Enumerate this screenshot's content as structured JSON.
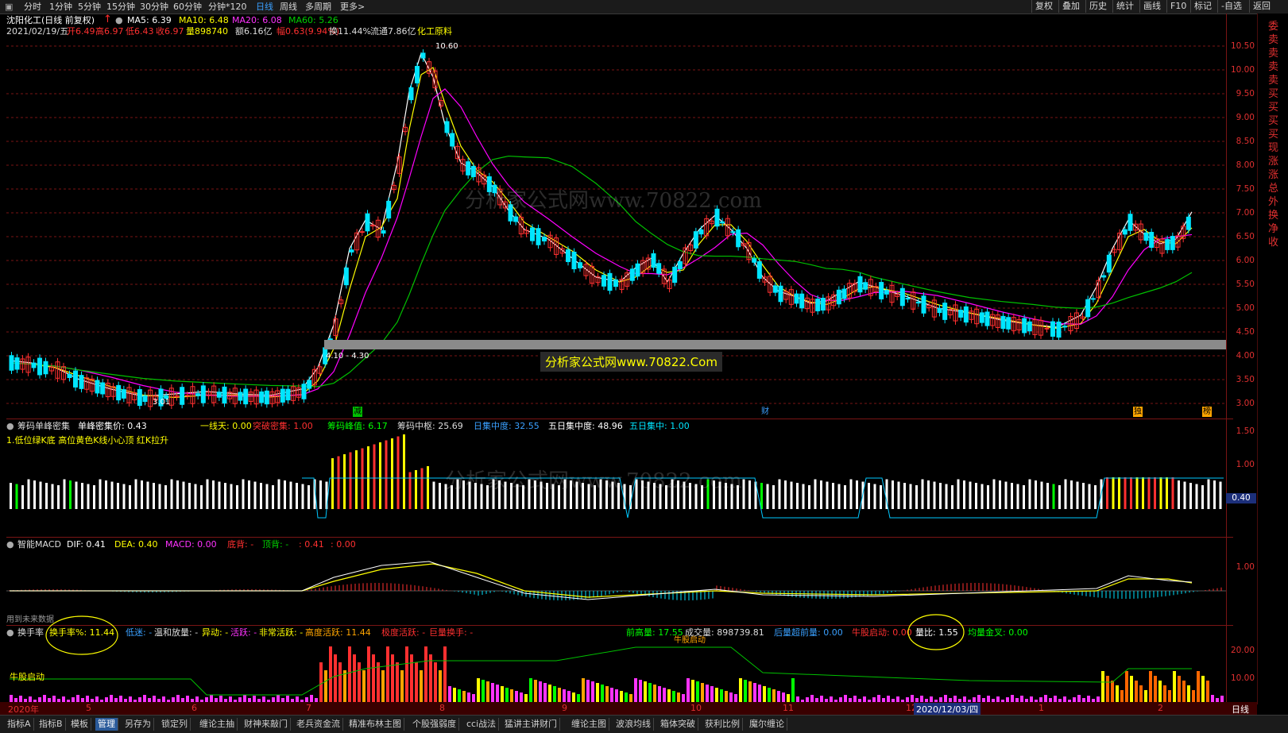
{
  "toolbar": {
    "tabs": [
      "分时",
      "1分钟",
      "5分钟",
      "15分钟",
      "30分钟",
      "60分钟",
      "分钟*120",
      "日线",
      "周线",
      "多周期",
      "更多>"
    ],
    "active_tab": "日线",
    "right_buttons": [
      "复权",
      "叠加",
      "历史",
      "统计",
      "画线",
      "F10",
      "标记",
      "-自选",
      "返回"
    ]
  },
  "main": {
    "stock_title": "沈阳化工(日线 前复权)",
    "ma5": "MA5: 6.39",
    "ma10": "MA10: 6.48",
    "ma20": "MA20: 6.08",
    "ma60": "MA60: 5.26",
    "date": "2021/02/19/五",
    "open": "开6.49",
    "high": "高6.97",
    "low": "低6.43",
    "close": "收6.97",
    "volume": "量898740",
    "amount": "额6.16亿",
    "change": "幅0.63(9.94%)",
    "turnover": "换11.44%",
    "float": "流通7.86亿",
    "sector": "化工原料",
    "high_label": "10.60",
    "low_label": "3.01",
    "range_label": "4.10 - 4.30",
    "banner": "分析家公式网www.70822.Com",
    "watermark": "分析家公式网www.70822.com",
    "markers": [
      "减",
      "财",
      "独",
      "榜"
    ],
    "axis": [
      "10.50",
      "10.00",
      "9.50",
      "9.00",
      "8.50",
      "8.00",
      "7.50",
      "7.00",
      "6.50",
      "6.00",
      "5.50",
      "5.00",
      "4.50",
      "4.00",
      "3.50",
      "3.00"
    ]
  },
  "chip": {
    "title": "筹码单峰密集",
    "price": "单峰密集价: 0.43",
    "yxt": "一线天: 0.00",
    "tpmj": "突破密集: 1.00",
    "peak": "筹码峰值: 6.17",
    "center": "筹码中枢: 25.69",
    "day_conc": "日集中度: 32.55",
    "five_conc": "五日集中度: 48.96",
    "five_set": "五日集中: 1.00",
    "note": "1.低位绿K底 高位黄色K线小心顶 红K拉升",
    "axis": [
      "1.50",
      "1.00",
      "0.40"
    ]
  },
  "macd": {
    "title": "智能MACD",
    "dif": "DIF: 0.41",
    "dea": "DEA: 0.40",
    "macd": "MACD: 0.00",
    "dibei": "底背: -",
    "dingbei": "顶背: -",
    "v1": ": 0.41",
    "v2": ": 0.00",
    "note": "用到未来数据",
    "axis": [
      "1.00"
    ]
  },
  "turnover": {
    "title": "换手率",
    "rate": "换手率%: 11.44",
    "low": "低迷: -",
    "mild": "温和放量: -",
    "abnormal": "异动: -",
    "active": "活跃: -",
    "very_active": "非常活跃: -",
    "high_active": "高度活跃: 11.44",
    "extreme": "极度活跃: -",
    "huge": "巨量换手: -",
    "prev_high": "前高量: 17.55",
    "volume": "成交量: 898739.81",
    "after_low": "后量超前量: 0.00",
    "bull_start": "牛股启动: 0.00",
    "ratio": "量比: 1.55",
    "golden": "均量金叉: 0.00",
    "start_label": "牛股启动",
    "start_label2": "牛股启动",
    "axis": [
      "20.00",
      "10.00"
    ]
  },
  "dates": [
    "2020年",
    "5",
    "6",
    "7",
    "8",
    "9",
    "10",
    "11",
    "12",
    "2020/12/03/四",
    "1",
    "2"
  ],
  "period_label": "日线",
  "bottom_tabs": [
    "指标A",
    "指标B",
    "模板",
    "管理",
    "另存为",
    "锁定列",
    "缠论主抽",
    "财神来敲门",
    "老兵资金流",
    "精准布林主图",
    "个股强弱度",
    "cci战法",
    "猛讲主讲财门",
    "缠论主图",
    "波浪均线",
    "箱体突破",
    "获利比例",
    "魔尔缠论"
  ],
  "right_column": [
    "委",
    "卖",
    "卖",
    "卖",
    "卖",
    "买",
    "买",
    "买",
    "买",
    "现",
    "涨",
    "涨",
    "总",
    "外",
    "换",
    "净",
    "收"
  ],
  "colors": {
    "up": "#ff3030",
    "down": "#00e5ff",
    "ma5": "#ffffff",
    "ma10": "#ffff00",
    "ma20": "#ff00ff",
    "ma60": "#00c000",
    "grid": "#7a1414"
  }
}
